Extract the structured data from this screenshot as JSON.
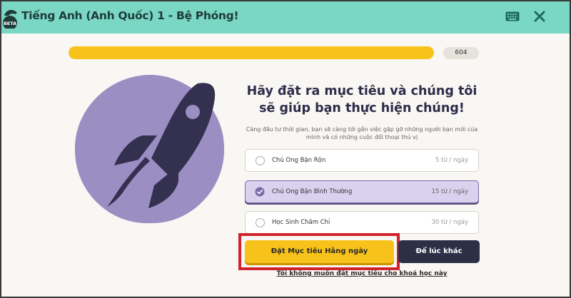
{
  "header": {
    "logo_badge": "BETA",
    "title": "Tiếng Anh (Anh Quốc) 1 - Bệ Phóng!",
    "icons": [
      "keyboard-icon",
      "close-icon"
    ]
  },
  "progress": {
    "fill_fraction": 1.0,
    "score": "604"
  },
  "goal": {
    "heading": "Hãy đặt ra mục tiêu và chúng tôi sẽ giúp bạn thực hiện chúng!",
    "subtext": "Càng đầu tư thời gian, bạn sẽ càng tới gần việc gặp gỡ những người bạn mới của mình và có những cuộc đối thoại thú vị",
    "options": [
      {
        "label": "Chú Ong Bận Rộn",
        "rate": "5 từ / ngày",
        "selected": false
      },
      {
        "label": "Chú Ong Bận Bình Thường",
        "rate": "15 từ / ngày",
        "selected": true
      },
      {
        "label": "Học Sinh Chăm Chỉ",
        "rate": "30 từ / ngày",
        "selected": false
      }
    ]
  },
  "actions": {
    "set_goal": "Đặt Mục tiêu Hằng ngày",
    "later": "Để lúc khác",
    "skip": "Tôi không muốn đặt mục tiêu cho khoá học này"
  },
  "colors": {
    "header_bg": "#79d7c3",
    "accent_yellow": "#f7c21a",
    "dark_button": "#2b3047",
    "selected_option": "#d9d1ee",
    "highlight_red": "#d0232b"
  }
}
